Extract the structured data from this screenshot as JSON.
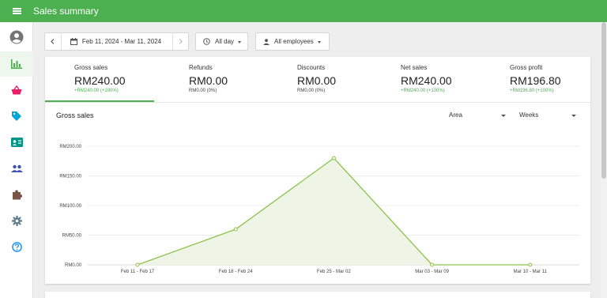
{
  "app": {
    "title": "Sales summary"
  },
  "sidebar": {
    "items": [
      {
        "icon": "account-circle-icon"
      },
      {
        "icon": "bar-chart-icon",
        "active": true
      },
      {
        "icon": "basket-icon"
      },
      {
        "icon": "tag-icon"
      },
      {
        "icon": "id-card-icon"
      },
      {
        "icon": "people-icon"
      },
      {
        "icon": "puzzle-icon"
      },
      {
        "icon": "gear-icon"
      },
      {
        "icon": "help-icon"
      }
    ]
  },
  "toolbar": {
    "date_range": "Feb 11, 2024 - Mar 11, 2024",
    "time_filter": "All day",
    "employee_filter": "All employees"
  },
  "metrics": [
    {
      "label": "Gross sales",
      "value": "RM240.00",
      "delta": "+RM240.00 (+100%)",
      "delta_color": "green",
      "active": true
    },
    {
      "label": "Refunds",
      "value": "RM0.00",
      "delta": "RM0.00 (0%)",
      "delta_color": "gray"
    },
    {
      "label": "Discounts",
      "value": "RM0.00",
      "delta": "RM0.00 (0%)",
      "delta_color": "gray"
    },
    {
      "label": "Net sales",
      "value": "RM240.00",
      "delta": "+RM240.00 (+100%)",
      "delta_color": "green"
    },
    {
      "label": "Gross profit",
      "value": "RM196.80",
      "delta": "+RM196.80 (+100%)",
      "delta_color": "green"
    }
  ],
  "chart_controls": {
    "chart_type": "Area",
    "period": "Weeks"
  },
  "colors": {
    "accent": "#4caf50",
    "line": "#8bc34a",
    "area_fill": "#eef5e6"
  },
  "chart_data": {
    "type": "area",
    "title": "Gross sales",
    "categories": [
      "Feb 11 - Feb 17",
      "Feb 18 - Feb 24",
      "Feb 25 - Mar 02",
      "Mar 03 - Mar 09",
      "Mar 10 - Mar 11"
    ],
    "values": [
      0,
      60,
      180,
      0,
      0
    ],
    "y_ticks": [
      "RM0.00",
      "RM50.00",
      "RM100.00",
      "RM150.00",
      "RM200.00"
    ],
    "ylim": [
      0,
      200
    ],
    "grid": true,
    "legend": "none"
  }
}
